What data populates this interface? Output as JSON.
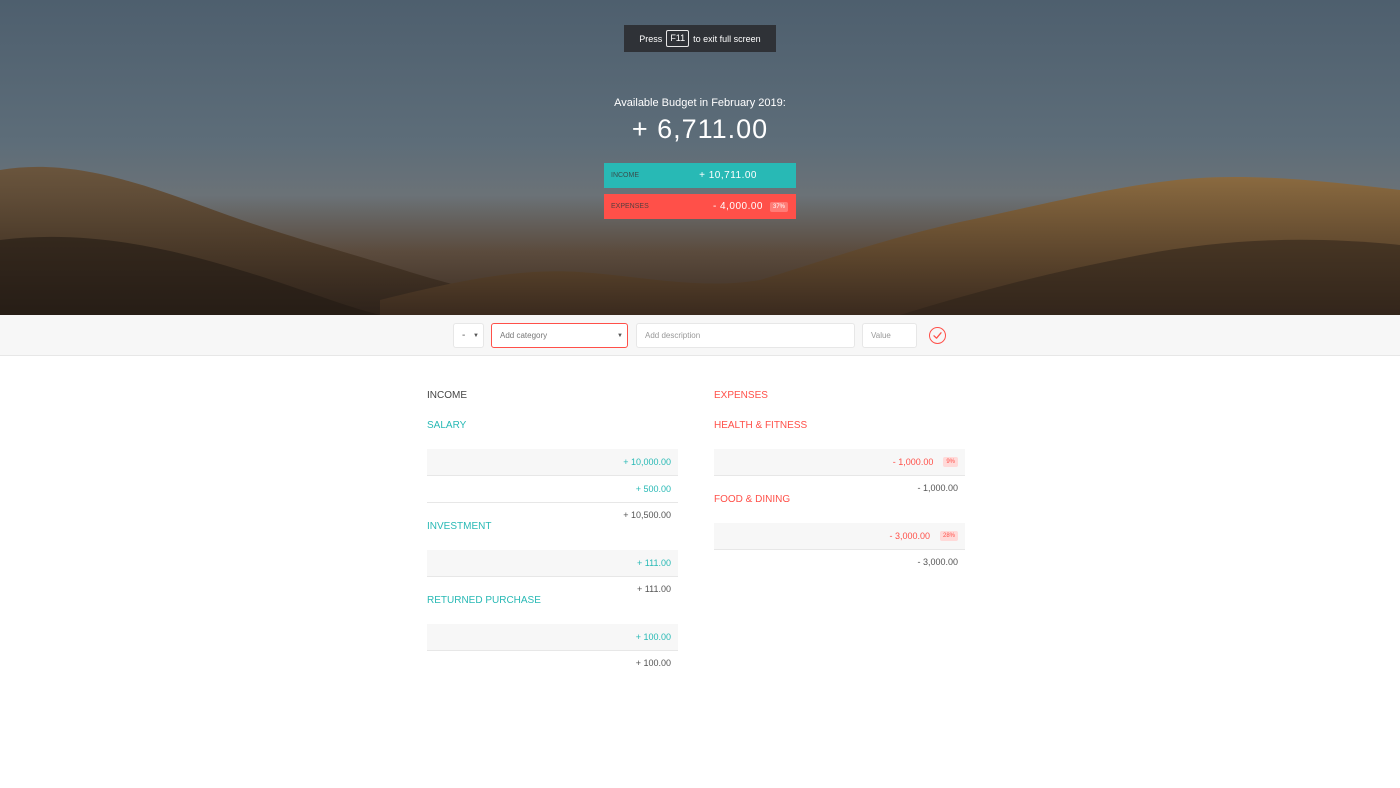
{
  "fullscreen_toast": {
    "before": "Press",
    "key": "F11",
    "after": "to exit full screen"
  },
  "budget": {
    "title": "Available Budget in February 2019:",
    "value": "+ 6,711.00",
    "income_label": "Income",
    "income_value": "+ 10,711.00",
    "expenses_label": "Expenses",
    "expenses_value": "- 4,000.00",
    "expenses_percentage": "37%"
  },
  "add_form": {
    "type_value": "-",
    "category_placeholder": "Add category",
    "description_placeholder": "Add description",
    "value_placeholder": "Value",
    "submit_icon": "check-circle-icon"
  },
  "income": {
    "title": "Income",
    "categories": [
      {
        "name": "Salary",
        "items": [
          "+ 10,000.00",
          "+ 500.00"
        ],
        "total": "+ 10,500.00"
      },
      {
        "name": "Investment",
        "items": [
          "+ 111.00"
        ],
        "total": "+ 111.00"
      },
      {
        "name": "Returned Purchase",
        "items": [
          "+ 100.00"
        ],
        "total": "+ 100.00"
      }
    ]
  },
  "expenses": {
    "title": "Expenses",
    "categories": [
      {
        "name": "Health & Fitness",
        "items": [
          {
            "value": "- 1,000.00",
            "percentage": "9%"
          }
        ],
        "total": "- 1,000.00"
      },
      {
        "name": "Food & Dining",
        "items": [
          {
            "value": "- 3,000.00",
            "percentage": "28%"
          }
        ],
        "total": "- 3,000.00"
      }
    ]
  },
  "colors": {
    "income": "#28b9b5",
    "expenses": "#ff5049"
  }
}
